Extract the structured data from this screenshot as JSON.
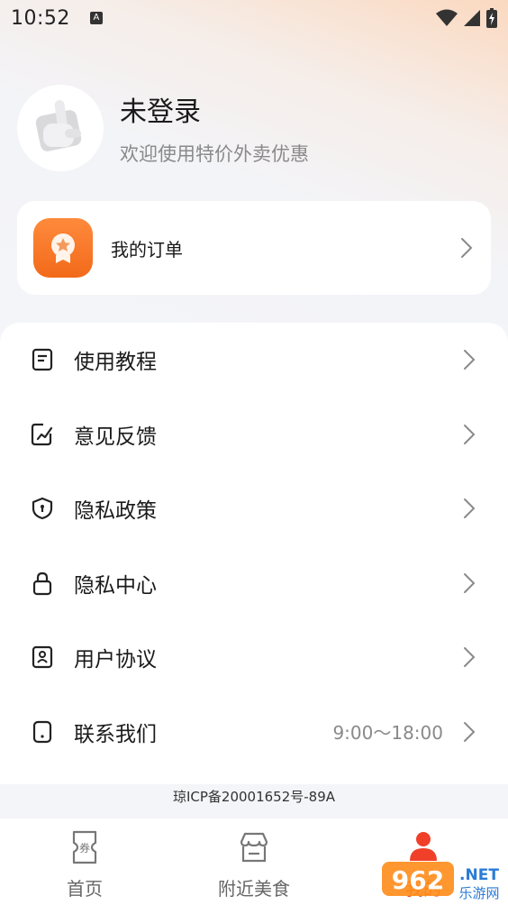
{
  "status_bar": {
    "time": "10:52",
    "notif": "A"
  },
  "profile": {
    "name": "未登录",
    "subtitle": "欢迎使用特价外卖优惠"
  },
  "order": {
    "label": "我的订单"
  },
  "menu": [
    {
      "label": "使用教程",
      "icon": "guide-icon",
      "extra": ""
    },
    {
      "label": "意见反馈",
      "icon": "feedback-icon",
      "extra": ""
    },
    {
      "label": "隐私政策",
      "icon": "shield-icon",
      "extra": ""
    },
    {
      "label": "隐私中心",
      "icon": "lock-icon",
      "extra": ""
    },
    {
      "label": "用户协议",
      "icon": "agreement-icon",
      "extra": ""
    },
    {
      "label": "联系我们",
      "icon": "phone-icon",
      "extra": "9:00～18:00"
    }
  ],
  "icp": "琼ICP备20001652号-89A",
  "tabs": [
    {
      "label": "首页",
      "icon": "coupon-icon",
      "active": false
    },
    {
      "label": "附近美食",
      "icon": "store-icon",
      "active": false
    },
    {
      "label": "我的",
      "icon": "user-icon",
      "active": true
    }
  ],
  "watermark": {
    "brand": "962",
    "domain": ".NET",
    "sub": "乐游网"
  },
  "colors": {
    "accent": "#f26a1a",
    "active_tab": "#e8552a",
    "text_muted": "#8a8a8a"
  }
}
